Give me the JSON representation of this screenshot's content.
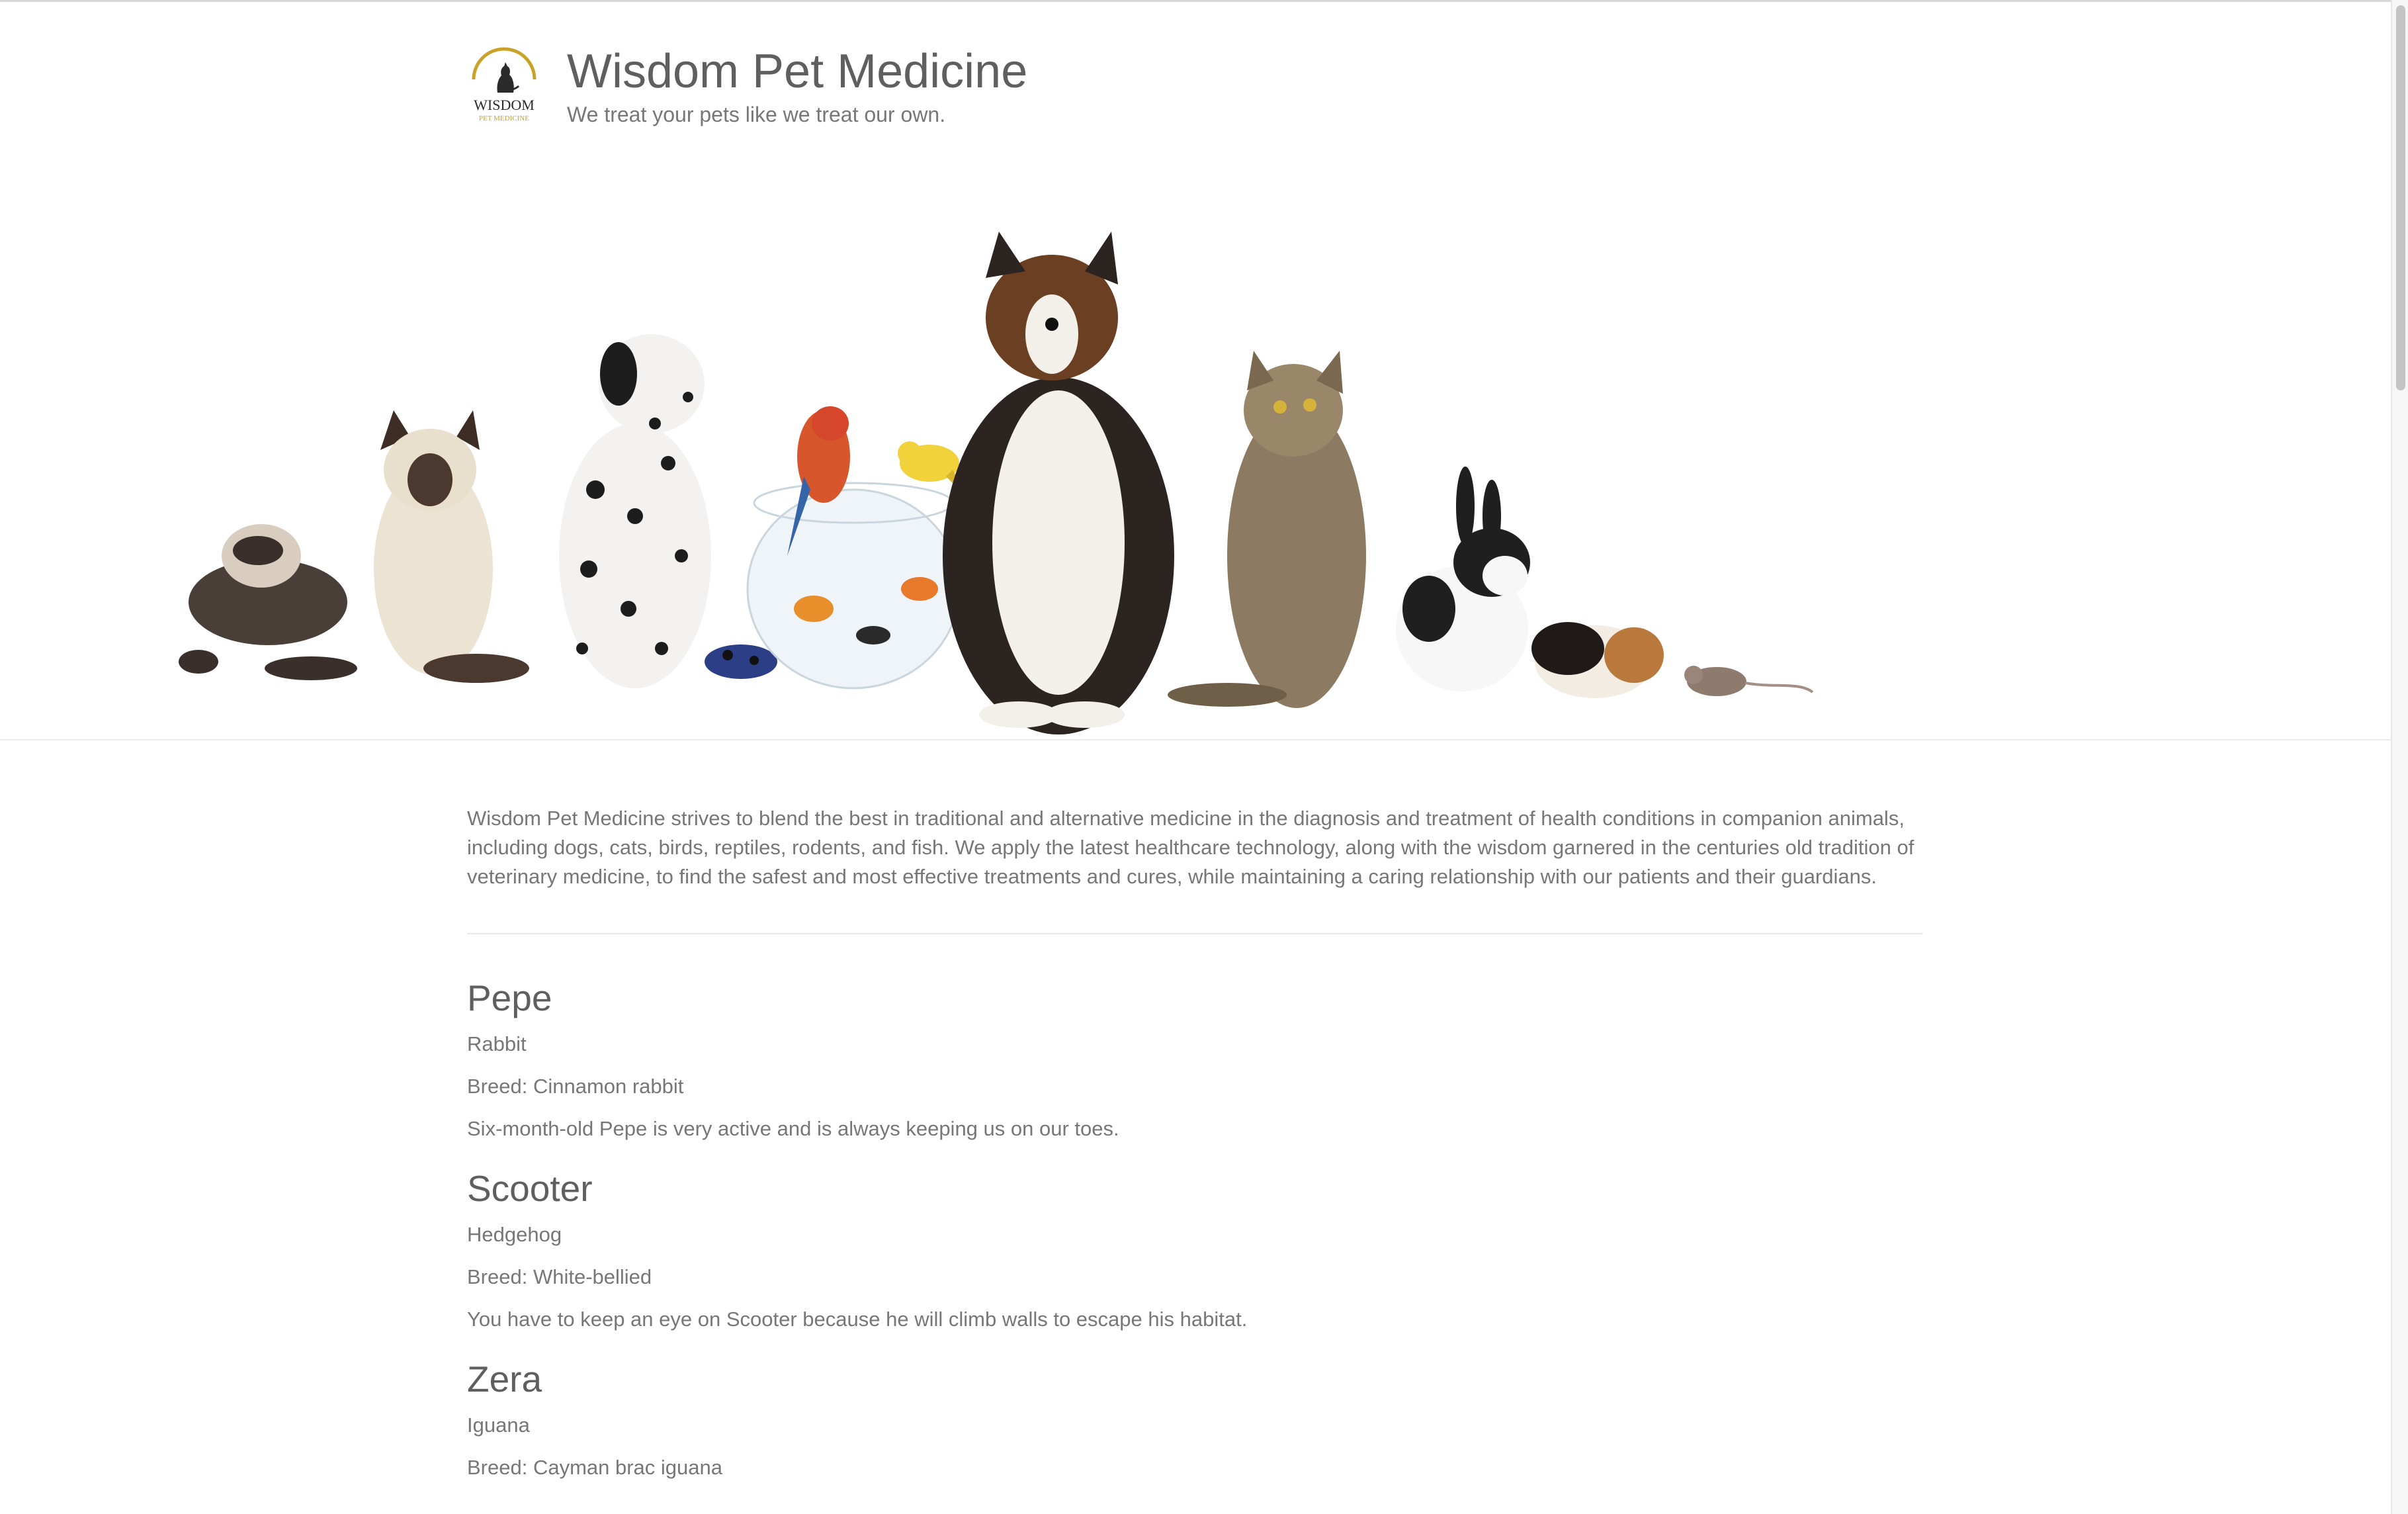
{
  "header": {
    "title": "Wisdom Pet Medicine",
    "tagline": "We treat your pets like we treat our own.",
    "logo_text": "WISDOM",
    "logo_subtext": "PET MEDICINE"
  },
  "hero": {
    "animals": [
      "ferret",
      "siamese cat",
      "dalmatian",
      "poison dart frog",
      "parrot",
      "canary",
      "goldfish bowl",
      "collie",
      "tabby cat",
      "rabbit",
      "guinea pig",
      "mouse"
    ]
  },
  "intro": "Wisdom Pet Medicine strives to blend the best in traditional and alternative medicine in the diagnosis and treatment of health conditions in companion animals, including dogs, cats, birds, reptiles, rodents, and fish. We apply the latest healthcare technology, along with the wisdom garnered in the centuries old tradition of veterinary medicine, to find the safest and most effective treatments and cures, while maintaining a caring relationship with our patients and their guardians.",
  "pets": [
    {
      "name": "Pepe",
      "species": "Rabbit",
      "breed": "Breed: Cinnamon rabbit",
      "description": "Six-month-old Pepe is very active and is always keeping us on our toes."
    },
    {
      "name": "Scooter",
      "species": "Hedgehog",
      "breed": "Breed: White-bellied",
      "description": "You have to keep an eye on Scooter because he will climb walls to escape his habitat."
    },
    {
      "name": "Zera",
      "species": "Iguana",
      "breed": "Breed: Cayman brac iguana"
    }
  ],
  "colors": {
    "text": "#777777",
    "heading": "#5f5f5f",
    "logo_gold": "#c9a227",
    "logo_dark": "#2b2b2b"
  }
}
